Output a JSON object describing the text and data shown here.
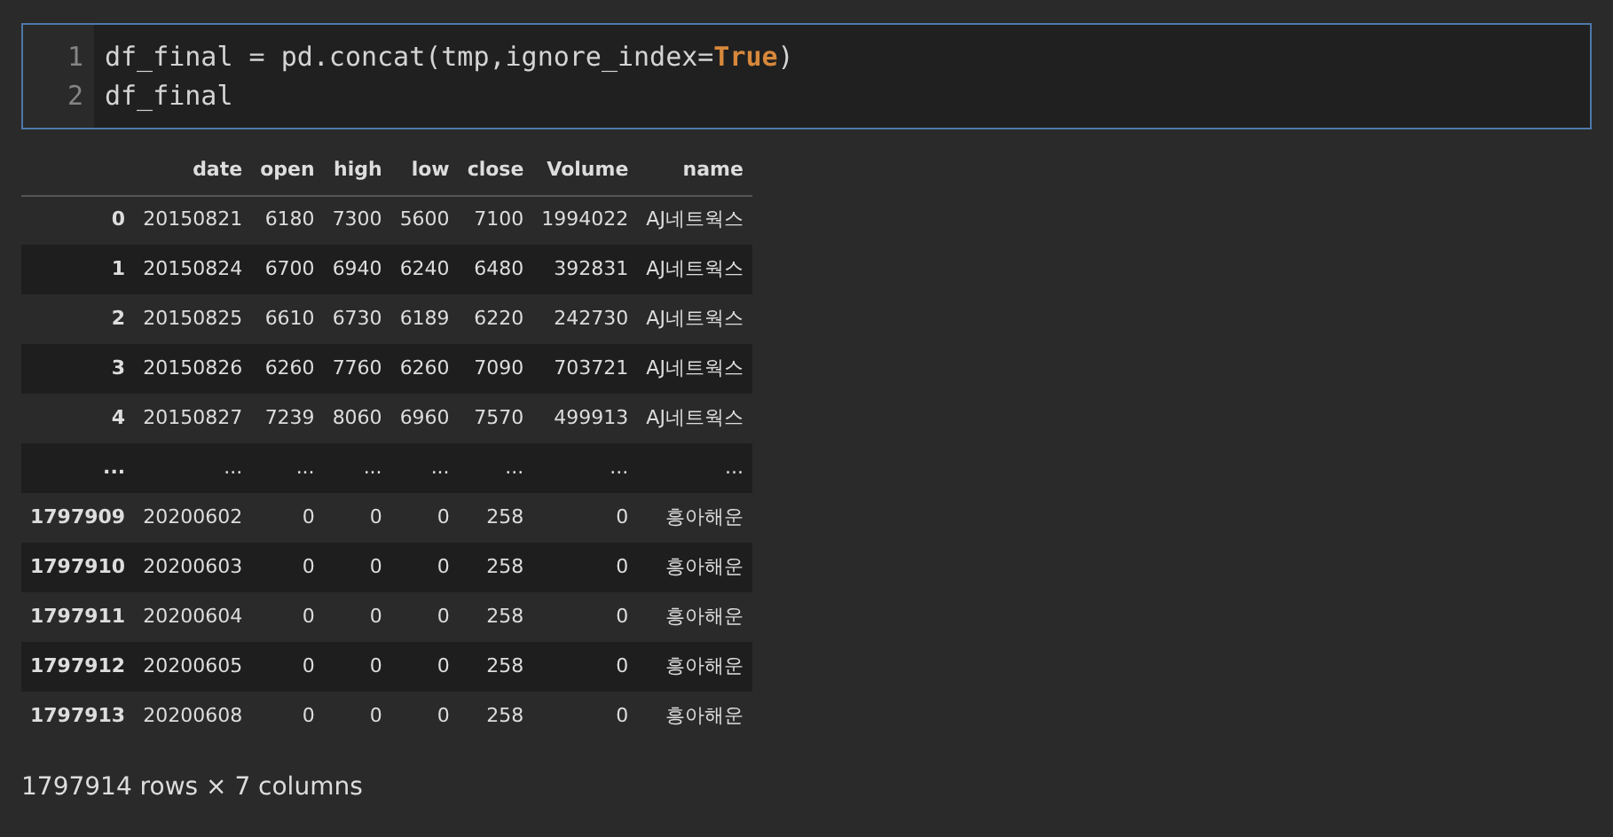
{
  "code_cell": {
    "lines": [
      {
        "number": "1",
        "tokens": [
          {
            "kind": "plain",
            "text": "df_final = pd.concat(tmp,ignore_index="
          },
          {
            "kind": "keyword",
            "text": "True"
          },
          {
            "kind": "plain",
            "text": ")"
          }
        ]
      },
      {
        "number": "2",
        "tokens": [
          {
            "kind": "plain",
            "text": "df_final"
          }
        ]
      }
    ]
  },
  "table": {
    "columns": [
      "",
      "date",
      "open",
      "high",
      "low",
      "close",
      "Volume",
      "name"
    ],
    "rows": [
      [
        "0",
        "20150821",
        "6180",
        "7300",
        "5600",
        "7100",
        "1994022",
        "AJ네트웍스"
      ],
      [
        "1",
        "20150824",
        "6700",
        "6940",
        "6240",
        "6480",
        "392831",
        "AJ네트웍스"
      ],
      [
        "2",
        "20150825",
        "6610",
        "6730",
        "6189",
        "6220",
        "242730",
        "AJ네트웍스"
      ],
      [
        "3",
        "20150826",
        "6260",
        "7760",
        "6260",
        "7090",
        "703721",
        "AJ네트웍스"
      ],
      [
        "4",
        "20150827",
        "7239",
        "8060",
        "6960",
        "7570",
        "499913",
        "AJ네트웍스"
      ],
      [
        "...",
        "...",
        "...",
        "...",
        "...",
        "...",
        "...",
        "..."
      ],
      [
        "1797909",
        "20200602",
        "0",
        "0",
        "0",
        "258",
        "0",
        "흥아해운"
      ],
      [
        "1797910",
        "20200603",
        "0",
        "0",
        "0",
        "258",
        "0",
        "흥아해운"
      ],
      [
        "1797911",
        "20200604",
        "0",
        "0",
        "0",
        "258",
        "0",
        "흥아해운"
      ],
      [
        "1797912",
        "20200605",
        "0",
        "0",
        "0",
        "258",
        "0",
        "흥아해운"
      ],
      [
        "1797913",
        "20200608",
        "0",
        "0",
        "0",
        "258",
        "0",
        "흥아해운"
      ]
    ]
  },
  "summary": "1797914 rows × 7 columns"
}
